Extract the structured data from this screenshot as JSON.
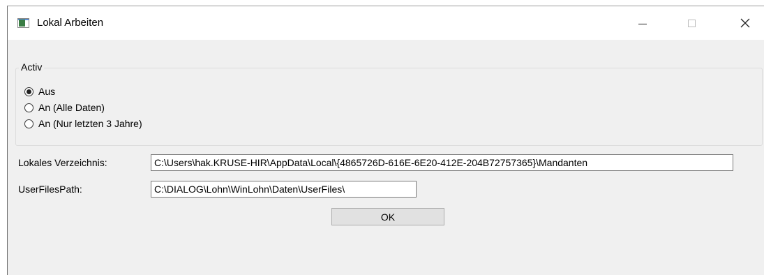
{
  "window": {
    "title": "Lokal Arbeiten",
    "minimize_label": "–",
    "maximize_label": "☐",
    "close_label": "✕"
  },
  "activ_group": {
    "legend": "Activ",
    "options": [
      {
        "label": "Aus",
        "checked": true
      },
      {
        "label": "An (Alle Daten)",
        "checked": false
      },
      {
        "label": "An (Nur letzten 3 Jahre)",
        "checked": false
      }
    ]
  },
  "fields": {
    "local_dir": {
      "label": "Lokales Verzeichnis:",
      "value": "C:\\Users\\hak.KRUSE-HIR\\AppData\\Local\\{4865726D-616E-6E20-412E-204B72757365}\\Mandanten"
    },
    "userfiles": {
      "label": "UserFilesPath:",
      "value": "C:\\DIALOG\\Lohn\\WinLohn\\Daten\\UserFiles\\"
    }
  },
  "buttons": {
    "ok": "OK"
  }
}
